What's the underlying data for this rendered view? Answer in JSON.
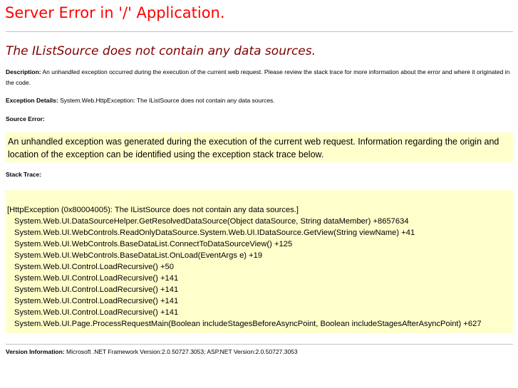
{
  "page": {
    "title": "Server Error in '/' Application.",
    "subtitle": "The IListSource does not contain any data sources.",
    "description_label": "Description:",
    "description_text": "An unhandled exception occurred during the execution of the current web request. Please review the stack trace for more information about the error and where it originated in the code.",
    "exception_label": "Exception Details:",
    "exception_text": "System.Web.HttpException: The IListSource does not contain any data sources.",
    "source_error_label": "Source Error:",
    "source_error_text": "An unhandled exception was generated during the execution of the current web request. Information regarding the origin and location of the exception can be identified using the exception stack trace below.",
    "stack_trace_label": "Stack Trace:",
    "stack_trace": [
      "[HttpException (0x80004005): The IListSource does not contain any data sources.]",
      "System.Web.UI.DataSourceHelper.GetResolvedDataSource(Object dataSource, String dataMember) +8657634",
      "System.Web.UI.WebControls.ReadOnlyDataSource.System.Web.UI.IDataSource.GetView(String viewName) +41",
      "System.Web.UI.WebControls.BaseDataList.ConnectToDataSourceView() +125",
      "System.Web.UI.WebControls.BaseDataList.OnLoad(EventArgs e) +19",
      "System.Web.UI.Control.LoadRecursive() +50",
      "System.Web.UI.Control.LoadRecursive() +141",
      "System.Web.UI.Control.LoadRecursive() +141",
      "System.Web.UI.Control.LoadRecursive() +141",
      "System.Web.UI.Control.LoadRecursive() +141",
      "System.Web.UI.Page.ProcessRequestMain(Boolean includeStagesBeforeAsyncPoint, Boolean includeStagesAfterAsyncPoint) +627"
    ],
    "version_label": "Version Information:",
    "version_text": "Microsoft .NET Framework Version:2.0.50727.3053; ASP.NET Version:2.0.50727.3053"
  },
  "colors": {
    "title": "#ff0000",
    "subtitle": "#800000",
    "box_background": "#ffffcc",
    "rule": "#c0c0c0"
  }
}
